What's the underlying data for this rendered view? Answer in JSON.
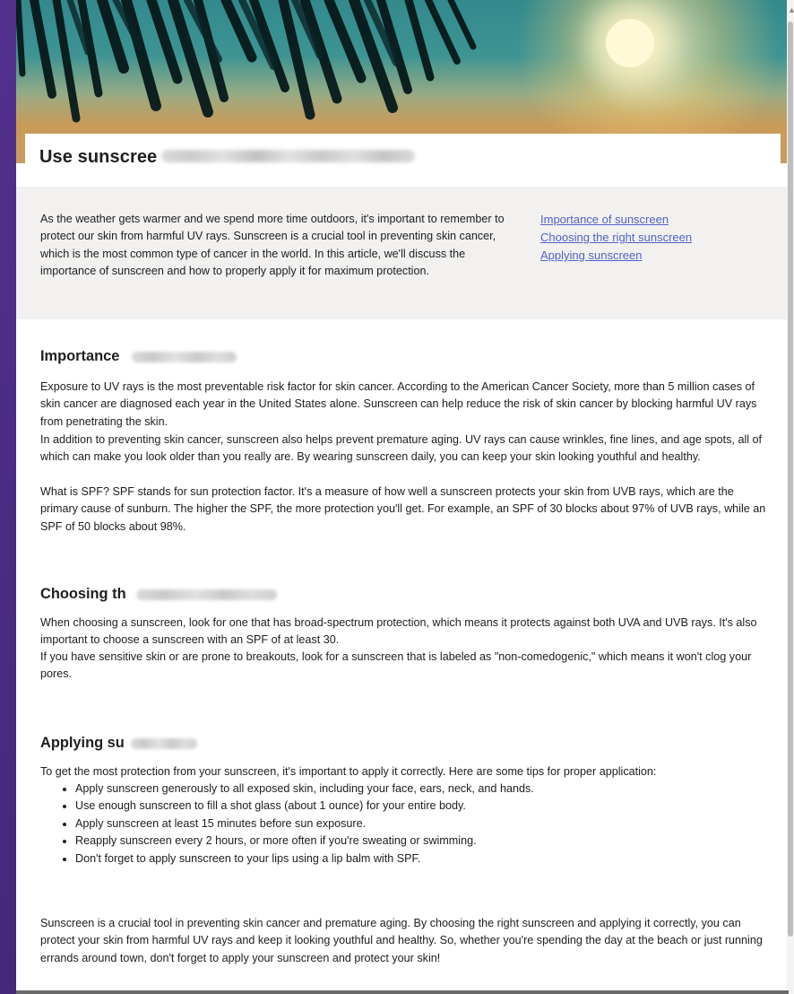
{
  "article": {
    "title_visible": "Use sunscree",
    "intro": "As the weather gets warmer and we spend more time outdoors, it's important to remember to protect our skin from harmful UV rays. Sunscreen is a crucial tool in preventing skin cancer, which is the most common type of cancer in the world. In this article, we'll discuss the importance of sunscreen and how to properly apply it for maximum protection.",
    "toc": [
      "Importance of sunscreen",
      "Choosing the right sunscreen",
      "Applying sunscreen"
    ],
    "sections": {
      "importance": {
        "heading_visible": "Importance",
        "paragraphs": [
          "Exposure to UV rays is the most preventable risk factor for skin cancer. According to the American Cancer Society, more than 5 million cases of skin cancer are diagnosed each year in the United States alone. Sunscreen can help reduce the risk of skin cancer by blocking harmful UV rays from penetrating the skin.",
          "In addition to preventing skin cancer, sunscreen also helps prevent premature aging. UV rays can cause wrinkles, fine lines, and age spots, all of which can make you look older than you really are. By wearing sunscreen daily, you can keep your skin looking youthful and healthy.",
          "What is SPF? SPF stands for sun protection factor. It's a measure of how well a sunscreen protects your skin from UVB rays, which are the primary cause of sunburn. The higher the SPF, the more protection you'll get. For example, an SPF of 30 blocks about 97% of UVB rays, while an SPF of 50 blocks about 98%."
        ]
      },
      "choosing": {
        "heading_visible": "Choosing th",
        "paragraphs": [
          "When choosing a sunscreen, look for one that has broad-spectrum protection, which means it protects against both UVA and UVB rays. It's also important to choose a sunscreen with an SPF of at least 30.",
          "If you have sensitive skin or are prone to breakouts, look for a sunscreen that is labeled as \"non-comedogenic,\" which means it won't clog your pores."
        ]
      },
      "applying": {
        "heading_visible": "Applying su",
        "lead": "To get the most protection from your sunscreen, it's important to apply it correctly. Here are some tips for proper application:",
        "tips": [
          "Apply sunscreen generously to all exposed skin, including your face, ears, neck, and hands.",
          "Use enough sunscreen to fill a shot glass (about 1 ounce) for your entire body.",
          "Apply sunscreen at least 15 minutes before sun exposure.",
          "Reapply sunscreen every 2 hours, or more often if you're sweating or swimming.",
          "Don't forget to apply sunscreen to your lips using a lip balm with SPF."
        ]
      }
    },
    "conclusion": "Sunscreen is a crucial tool in preventing skin cancer and premature aging. By choosing the right sunscreen and applying it correctly, you can protect your skin from harmful UV rays and keep it looking youthful and healthy. So, whether you're spending the day at the beach or just running errands around town, don't forget to apply your sunscreen and protect your skin!"
  },
  "ui": {
    "scroll_up_glyph": "▲",
    "scrollbar_icon": "scroll-up-arrow-icon"
  },
  "colors": {
    "window_background": "#ffffff",
    "intro_background": "#f2f1f0",
    "link": "#5362c7",
    "text": "#202020",
    "outer_background": "#4b2a86"
  }
}
